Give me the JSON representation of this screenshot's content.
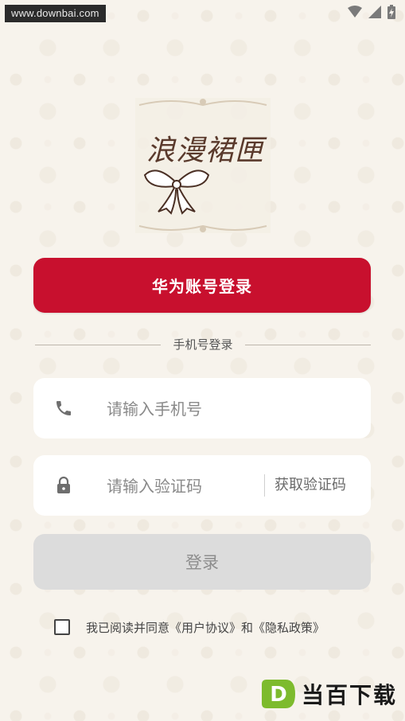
{
  "status_bar": {
    "watermark_url": "www.downbai.com",
    "icons": [
      "wifi-icon",
      "signal-icon",
      "battery-icon"
    ]
  },
  "logo": {
    "title": "浪漫裙匣",
    "icon": "bow-icon"
  },
  "huawei_login": {
    "label": "华为账号登录"
  },
  "divider": {
    "label": "手机号登录"
  },
  "phone_field": {
    "placeholder": "请输入手机号",
    "value": "",
    "icon": "phone-icon"
  },
  "code_field": {
    "placeholder": "请输入验证码",
    "value": "",
    "icon": "lock-icon",
    "get_code_label": "获取验证码"
  },
  "login_button": {
    "label": "登录"
  },
  "agreement": {
    "text": "我已阅读并同意《用户协议》和《隐私政策》",
    "checked": false
  },
  "corner_brand": {
    "text": "当百下载",
    "logo_letter": "D"
  },
  "colors": {
    "primary": "#c8102e",
    "background": "#f7f3ec",
    "disabled": "#dcdcdc",
    "logo_brown": "#5a3a2c",
    "brand_green": "#7dbb2d"
  }
}
